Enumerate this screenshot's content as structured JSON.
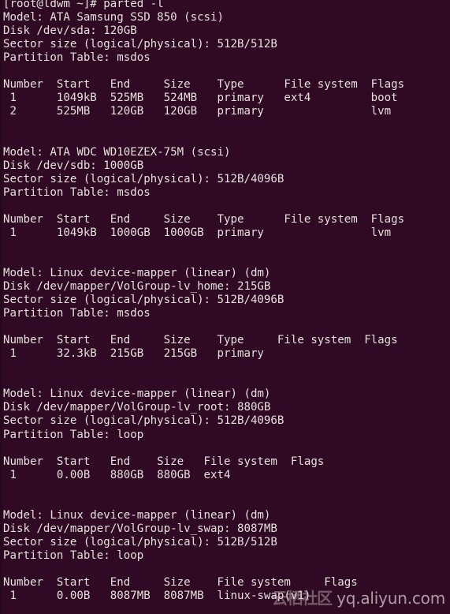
{
  "terminal": {
    "colors": {
      "background": "#300a24",
      "foreground": "#e6e1dd",
      "border": "#24081c"
    },
    "prompt": "[root@ldwm ~]#",
    "command": "parted -l",
    "user": "root",
    "host": "ldwm",
    "cwd": "~",
    "lines": [
      "[root@ldwm ~]# parted -l",
      "Model: ATA Samsung SSD 850 (scsi)",
      "Disk /dev/sda: 120GB",
      "Sector size (logical/physical): 512B/512B",
      "Partition Table: msdos",
      "",
      "Number  Start   End     Size    Type      File system  Flags",
      " 1      1049kB  525MB   524MB   primary   ext4         boot",
      " 2      525MB   120GB   120GB   primary                lvm",
      "",
      "",
      "Model: ATA WDC WD10EZEX-75M (scsi)",
      "Disk /dev/sdb: 1000GB",
      "Sector size (logical/physical): 512B/4096B",
      "Partition Table: msdos",
      "",
      "Number  Start   End     Size    Type      File system  Flags",
      " 1      1049kB  1000GB  1000GB  primary                lvm",
      "",
      "",
      "Model: Linux device-mapper (linear) (dm)",
      "Disk /dev/mapper/VolGroup-lv_home: 215GB",
      "Sector size (logical/physical): 512B/4096B",
      "Partition Table: msdos",
      "",
      "Number  Start   End     Size    Type     File system  Flags",
      " 1      32.3kB  215GB   215GB   primary",
      "",
      "",
      "Model: Linux device-mapper (linear) (dm)",
      "Disk /dev/mapper/VolGroup-lv_root: 880GB",
      "Sector size (logical/physical): 512B/4096B",
      "Partition Table: loop",
      "",
      "Number  Start   End    Size   File system  Flags",
      " 1      0.00B   880GB  880GB  ext4",
      "",
      "",
      "Model: Linux device-mapper (linear) (dm)",
      "Disk /dev/mapper/VolGroup-lv_swap: 8087MB",
      "Sector size (logical/physical): 512B/512B",
      "Partition Table: loop",
      "",
      "Number  Start   End     Size    File system     Flags",
      " 1      0.00B   8087MB  8087MB  linux-swap(v1)"
    ],
    "blocks": [
      {
        "model": "ATA Samsung SSD 850 (scsi)",
        "disk": "/dev/sda",
        "disk_size": "120GB",
        "sector_size": "512B/512B",
        "partition_table": "msdos",
        "headers": [
          "Number",
          "Start",
          "End",
          "Size",
          "Type",
          "File system",
          "Flags"
        ],
        "rows": [
          [
            "1",
            "1049kB",
            "525MB",
            "524MB",
            "primary",
            "ext4",
            "boot"
          ],
          [
            "2",
            "525MB",
            "120GB",
            "120GB",
            "primary",
            "",
            "lvm"
          ]
        ]
      },
      {
        "model": "ATA WDC WD10EZEX-75M (scsi)",
        "disk": "/dev/sdb",
        "disk_size": "1000GB",
        "sector_size": "512B/4096B",
        "partition_table": "msdos",
        "headers": [
          "Number",
          "Start",
          "End",
          "Size",
          "Type",
          "File system",
          "Flags"
        ],
        "rows": [
          [
            "1",
            "1049kB",
            "1000GB",
            "1000GB",
            "primary",
            "",
            "lvm"
          ]
        ]
      },
      {
        "model": "Linux device-mapper (linear) (dm)",
        "disk": "/dev/mapper/VolGroup-lv_home",
        "disk_size": "215GB",
        "sector_size": "512B/4096B",
        "partition_table": "msdos",
        "headers": [
          "Number",
          "Start",
          "End",
          "Size",
          "Type",
          "File system",
          "Flags"
        ],
        "rows": [
          [
            "1",
            "32.3kB",
            "215GB",
            "215GB",
            "primary",
            "",
            ""
          ]
        ]
      },
      {
        "model": "Linux device-mapper (linear) (dm)",
        "disk": "/dev/mapper/VolGroup-lv_root",
        "disk_size": "880GB",
        "sector_size": "512B/4096B",
        "partition_table": "loop",
        "headers": [
          "Number",
          "Start",
          "End",
          "Size",
          "File system",
          "Flags"
        ],
        "rows": [
          [
            "1",
            "0.00B",
            "880GB",
            "880GB",
            "ext4",
            ""
          ]
        ]
      },
      {
        "model": "Linux device-mapper (linear) (dm)",
        "disk": "/dev/mapper/VolGroup-lv_swap",
        "disk_size": "8087MB",
        "sector_size": "512B/512B",
        "partition_table": "loop",
        "headers": [
          "Number",
          "Start",
          "End",
          "Size",
          "File system",
          "Flags"
        ],
        "rows": [
          [
            "1",
            "0.00B",
            "8087MB",
            "8087MB",
            "linux-swap(v1)",
            ""
          ]
        ]
      }
    ]
  },
  "watermark": {
    "cjk": "云栖社区",
    "url": "yq.aliyun.com"
  }
}
